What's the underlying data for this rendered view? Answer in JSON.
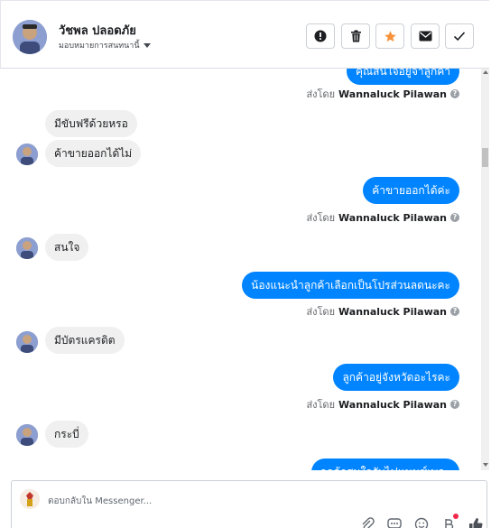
{
  "header": {
    "contact_name": "วัชพล ปลอดภัย",
    "assign_label": "มอบหมายการสนทนานี้",
    "buttons": [
      {
        "icon": "alert-icon",
        "color": "#1c1e21"
      },
      {
        "icon": "trash-icon",
        "color": "#1c1e21"
      },
      {
        "icon": "star-icon",
        "color": "#f7923b"
      },
      {
        "icon": "envelope-icon",
        "color": "#1c1e21"
      },
      {
        "icon": "check-icon",
        "color": "#1c1e21"
      }
    ]
  },
  "conversation": {
    "sent_by_prefix": "ส่งโดย",
    "sender_name": "Wannaluck Pilawan",
    "help_glyph": "?",
    "messages": [
      {
        "direction": "out",
        "text": "คุณสนใจอยู่จำลูกค้า"
      },
      {
        "direction": "in",
        "text": "มีขับฟรีด้วยหรอ"
      },
      {
        "direction": "in",
        "text": "ค้าขายออกได้ไม่"
      },
      {
        "direction": "out",
        "text": "ค้าขายออกได้ค่ะ"
      },
      {
        "direction": "in",
        "text": "สนใจ"
      },
      {
        "direction": "out",
        "text": "น้องแนะนำลูกค้าเลือกเป็นโปรส่วนลดนะคะ"
      },
      {
        "direction": "in",
        "text": "มีบัตรแครดิต"
      },
      {
        "direction": "out",
        "text": "ลูกค้าอยู่จังหวัดอะไรคะ"
      },
      {
        "direction": "in",
        "text": "กระบี่"
      },
      {
        "direction": "out",
        "text": "ลูกค้าสนใจรับไฟแนนซ์เพอะ"
      }
    ]
  },
  "reply": {
    "placeholder": "ตอบกลับใน Messenger..."
  },
  "colors": {
    "outgoing_bubble": "#0084ff",
    "incoming_bubble": "#f0f0f0",
    "star_accent": "#f7923b",
    "notification_dot": "#f02849"
  }
}
